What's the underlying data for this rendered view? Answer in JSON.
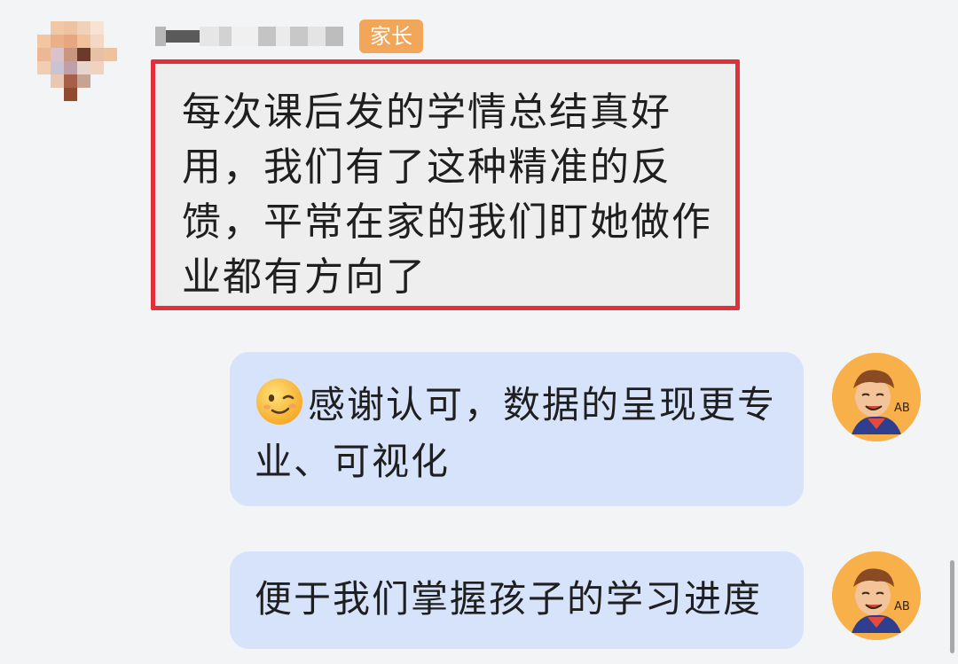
{
  "incoming_message": {
    "sender_role_badge": "家长",
    "text": "每次课后发的学情总结真好用，我们有了这种精准的反馈，平常在家的我们盯她做作业都有方向了",
    "highlight_color": "#e0303a"
  },
  "outgoing_messages": [
    {
      "text": "感谢认可，数据的呈现更专业、可视化",
      "has_emoji": true,
      "emoji": "winking-face-icon"
    },
    {
      "text": "便于我们掌握孩子的学习进度",
      "has_emoji": false
    }
  ],
  "self_avatar_label": "AB",
  "colors": {
    "background": "#f3f4f6",
    "outgoing_bubble": "#d6e3fb",
    "incoming_bubble": "#eeeeee",
    "badge": "#f2a65a"
  }
}
